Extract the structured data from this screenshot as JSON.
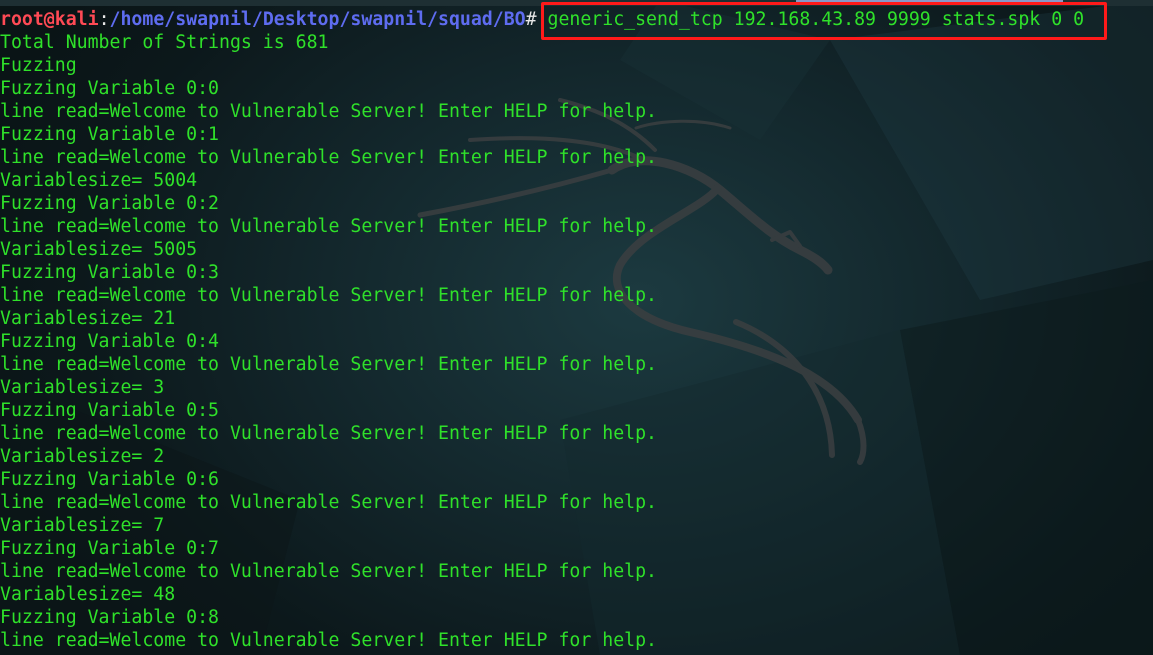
{
  "window": {
    "accent_color": "#8a97c8"
  },
  "prompt": {
    "user_host": "root@kali",
    "separator": ":",
    "path": "/home/swapnil/Desktop/swapnil/squad/BO",
    "symbol": "#",
    "command": " generic_send_tcp 192.168.43.89 9999 stats.spk 0 0"
  },
  "output_lines": [
    "Total Number of Strings is 681",
    "Fuzzing",
    "Fuzzing Variable 0:0",
    "line read=Welcome to Vulnerable Server! Enter HELP for help.",
    "Fuzzing Variable 0:1",
    "line read=Welcome to Vulnerable Server! Enter HELP for help.",
    "Variablesize= 5004",
    "Fuzzing Variable 0:2",
    "line read=Welcome to Vulnerable Server! Enter HELP for help.",
    "Variablesize= 5005",
    "Fuzzing Variable 0:3",
    "line read=Welcome to Vulnerable Server! Enter HELP for help.",
    "Variablesize= 21",
    "Fuzzing Variable 0:4",
    "line read=Welcome to Vulnerable Server! Enter HELP for help.",
    "Variablesize= 3",
    "Fuzzing Variable 0:5",
    "line read=Welcome to Vulnerable Server! Enter HELP for help.",
    "Variablesize= 2",
    "Fuzzing Variable 0:6",
    "line read=Welcome to Vulnerable Server! Enter HELP for help.",
    "Variablesize= 7",
    "Fuzzing Variable 0:7",
    "line read=Welcome to Vulnerable Server! Enter HELP for help.",
    "Variablesize= 48",
    "Fuzzing Variable 0:8",
    "line read=Welcome to Vulnerable Server! Enter HELP for help."
  ],
  "colors": {
    "output_text": "#2fe12a",
    "prompt_user": "#ff4a55",
    "prompt_path": "#5e6cf0",
    "highlight_box": "#ff1a1a"
  },
  "background": {
    "logo": "kali-dragon-logo"
  }
}
